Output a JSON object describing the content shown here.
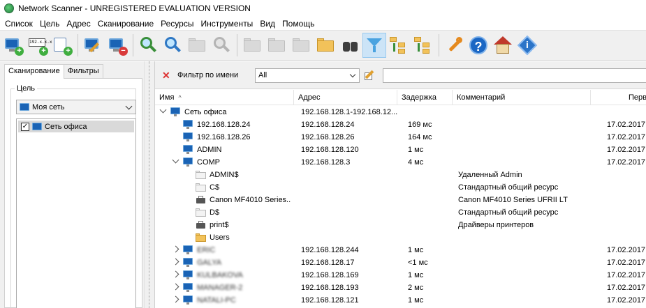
{
  "window": {
    "title": "Network Scanner - UNREGISTERED EVALUATION VERSION"
  },
  "menu": [
    "Список",
    "Цель",
    "Адрес",
    "Сканирование",
    "Ресурсы",
    "Инструменты",
    "Вид",
    "Помощь"
  ],
  "toolbar": {
    "buttons": [
      {
        "name": "add-computer-icon",
        "enabled": true
      },
      {
        "name": "add-ip-range-icon",
        "enabled": true,
        "text": "192.x.x.x"
      },
      {
        "name": "add-from-list-icon",
        "enabled": true
      },
      {
        "name": "edit-target-icon",
        "enabled": true
      },
      {
        "name": "remove-target-icon",
        "enabled": true
      },
      {
        "name": "scan-icon",
        "enabled": true
      },
      {
        "name": "rescan-icon",
        "enabled": true
      },
      {
        "name": "scan-selected-icon",
        "enabled": false
      },
      {
        "name": "stop-scan-icon",
        "enabled": false
      },
      {
        "name": "open-resource-icon",
        "enabled": false
      },
      {
        "name": "edit-resource-icon",
        "enabled": false
      },
      {
        "name": "delete-resource-icon",
        "enabled": false
      },
      {
        "name": "open-folder-icon",
        "enabled": true
      },
      {
        "name": "find-icon",
        "enabled": true
      },
      {
        "name": "filter-icon",
        "enabled": true,
        "active": true
      },
      {
        "name": "expand-tree-icon",
        "enabled": true
      },
      {
        "name": "collapse-tree-icon",
        "enabled": true
      },
      {
        "name": "options-icon",
        "enabled": true
      },
      {
        "name": "help-icon",
        "enabled": true
      },
      {
        "name": "home-icon",
        "enabled": true
      },
      {
        "name": "about-icon",
        "enabled": true
      }
    ]
  },
  "left_panel": {
    "tabs": [
      "Сканирование",
      "Фильтры"
    ],
    "active_tab": 0,
    "group_label": "Цель",
    "target_select": "Моя сеть",
    "targets": [
      {
        "label": "Сеть офиса",
        "checked": true
      }
    ]
  },
  "filter": {
    "label": "Фильтр по имени",
    "mode": "All",
    "text": ""
  },
  "grid": {
    "columns": [
      "Имя",
      "Адрес",
      "Задержка",
      "Комментарий",
      "Перв"
    ],
    "rows": [
      {
        "level": 0,
        "expander": "down",
        "icon": "network",
        "name": "Сеть офиса",
        "address": "192.168.128.1-192.168.12...",
        "latency": "",
        "comment": "",
        "first": "",
        "blur": false
      },
      {
        "level": 1,
        "expander": "",
        "icon": "computer",
        "name": "192.168.128.24",
        "address": "192.168.128.24",
        "latency": "169 мс",
        "comment": "",
        "first": "17.02.2017",
        "blur": false
      },
      {
        "level": 1,
        "expander": "",
        "icon": "computer",
        "name": "192.168.128.26",
        "address": "192.168.128.26",
        "latency": "164 мс",
        "comment": "",
        "first": "17.02.2017",
        "blur": false
      },
      {
        "level": 1,
        "expander": "",
        "icon": "computer",
        "name": "ADMIN",
        "address": "192.168.128.120",
        "latency": "1 мс",
        "comment": "",
        "first": "17.02.2017",
        "blur": false
      },
      {
        "level": 1,
        "expander": "down",
        "icon": "computer",
        "name": "COMP",
        "address": "192.168.128.3",
        "latency": "4 мс",
        "comment": "",
        "first": "17.02.2017",
        "blur": false
      },
      {
        "level": 2,
        "expander": "",
        "icon": "share-gray",
        "name": "ADMIN$",
        "address": "",
        "latency": "",
        "comment": "Удаленный Admin",
        "first": "",
        "blur": false
      },
      {
        "level": 2,
        "expander": "",
        "icon": "share-gray",
        "name": "C$",
        "address": "",
        "latency": "",
        "comment": "Стандартный общий ресурс",
        "first": "",
        "blur": false
      },
      {
        "level": 2,
        "expander": "",
        "icon": "printer",
        "name": "Canon MF4010 Series...",
        "address": "",
        "latency": "",
        "comment": "Canon MF4010 Series UFRII LT",
        "first": "",
        "blur": false
      },
      {
        "level": 2,
        "expander": "",
        "icon": "share-gray",
        "name": "D$",
        "address": "",
        "latency": "",
        "comment": "Стандартный общий ресурс",
        "first": "",
        "blur": false
      },
      {
        "level": 2,
        "expander": "",
        "icon": "printer",
        "name": "print$",
        "address": "",
        "latency": "",
        "comment": "Драйверы принтеров",
        "first": "",
        "blur": false
      },
      {
        "level": 2,
        "expander": "",
        "icon": "share-yellow",
        "name": "Users",
        "address": "",
        "latency": "",
        "comment": "",
        "first": "",
        "blur": false
      },
      {
        "level": 1,
        "expander": "right",
        "icon": "computer",
        "name": "ERIC",
        "address": "192.168.128.244",
        "latency": "1 мс",
        "comment": "",
        "first": "17.02.2017",
        "blur": true
      },
      {
        "level": 1,
        "expander": "right",
        "icon": "computer",
        "name": "GALYA",
        "address": "192.168.128.17",
        "latency": "<1 мс",
        "comment": "",
        "first": "17.02.2017",
        "blur": true
      },
      {
        "level": 1,
        "expander": "right",
        "icon": "computer",
        "name": "KULBAKOVA",
        "address": "192.168.128.169",
        "latency": "1 мс",
        "comment": "",
        "first": "17.02.2017",
        "blur": true
      },
      {
        "level": 1,
        "expander": "right",
        "icon": "computer",
        "name": "MANAGER-2",
        "address": "192.168.128.193",
        "latency": "2 мс",
        "comment": "",
        "first": "17.02.2017",
        "blur": true
      },
      {
        "level": 1,
        "expander": "right",
        "icon": "computer",
        "name": "NATALI-PC",
        "address": "192.168.128.121",
        "latency": "1 мс",
        "comment": "",
        "first": "17.02.2017",
        "blur": true
      }
    ]
  }
}
